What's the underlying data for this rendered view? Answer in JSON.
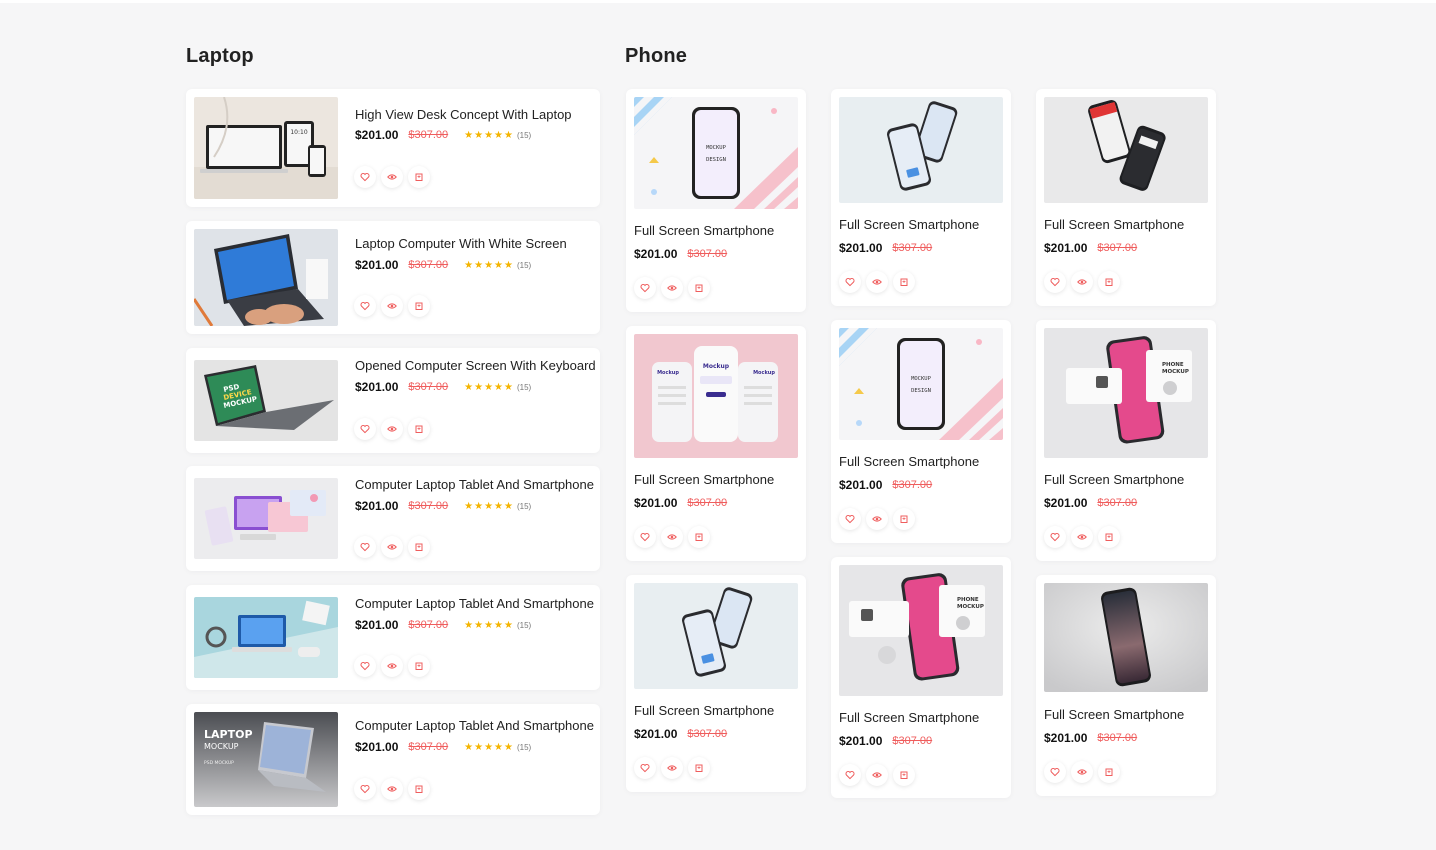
{
  "sections": {
    "laptop": {
      "title": "Laptop"
    },
    "phone": {
      "title": "Phone"
    }
  },
  "laptop_items": [
    {
      "title": "High View Desk Concept With Laptop",
      "price": "$201.00",
      "old_price": "$307.00",
      "stars": "★★★★★",
      "count": "(15)"
    },
    {
      "title": "Laptop Computer With White Screen",
      "price": "$201.00",
      "old_price": "$307.00",
      "stars": "★★★★★",
      "count": "(15)"
    },
    {
      "title": "Opened Computer Screen With Keyboard",
      "price": "$201.00",
      "old_price": "$307.00",
      "stars": "★★★★★",
      "count": "(15)"
    },
    {
      "title": "Computer Laptop Tablet And Smartphone",
      "price": "$201.00",
      "old_price": "$307.00",
      "stars": "★★★★★",
      "count": "(15)"
    },
    {
      "title": "Computer Laptop Tablet And Smartphone",
      "price": "$201.00",
      "old_price": "$307.00",
      "stars": "★★★★★",
      "count": "(15)"
    },
    {
      "title": "Computer Laptop Tablet And Smartphone",
      "price": "$201.00",
      "old_price": "$307.00",
      "stars": "★★★★★",
      "count": "(15)"
    }
  ],
  "phone_items": [
    {
      "title": "Full Screen Smartphone",
      "price": "$201.00",
      "old_price": "$307.00"
    },
    {
      "title": "Full Screen Smartphone",
      "price": "$201.00",
      "old_price": "$307.00"
    },
    {
      "title": "Full Screen Smartphone",
      "price": "$201.00",
      "old_price": "$307.00"
    },
    {
      "title": "Full Screen Smartphone",
      "price": "$201.00",
      "old_price": "$307.00"
    },
    {
      "title": "Full Screen Smartphone",
      "price": "$201.00",
      "old_price": "$307.00"
    },
    {
      "title": "Full Screen Smartphone",
      "price": "$201.00",
      "old_price": "$307.00"
    },
    {
      "title": "Full Screen Smartphone",
      "price": "$201.00",
      "old_price": "$307.00"
    },
    {
      "title": "Full Screen Smartphone",
      "price": "$201.00",
      "old_price": "$307.00"
    },
    {
      "title": "Full Screen Smartphone",
      "price": "$201.00",
      "old_price": "$307.00"
    }
  ],
  "thumb_text": {
    "mockup_design": [
      "MOCKUP",
      "DESIGN"
    ],
    "iphone_mockup": "Mockup",
    "device_mockup": [
      "PSD",
      "DEVICE",
      "MOCKUP"
    ],
    "laptop_mockup": [
      "LAPTOP",
      "MOCKUP",
      "PSD MOCKUP"
    ],
    "phone_mockup": [
      "PHONE",
      "MOCKUP"
    ],
    "clock": "10:10"
  },
  "icons": [
    "heart-icon",
    "eye-icon",
    "cart-icon"
  ],
  "colors": {
    "accent": "#ef5d5d",
    "star": "#f4b400",
    "background": "#f6f6f7"
  }
}
